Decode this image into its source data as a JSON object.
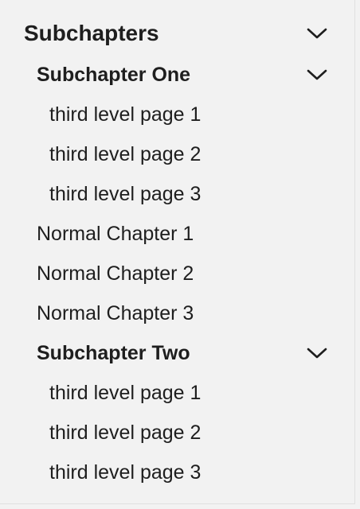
{
  "nav": {
    "section_title": "Subchapters",
    "sub_one": {
      "label": "Subchapter One",
      "pages": [
        "third level page 1",
        "third level page 2",
        "third level page 3"
      ]
    },
    "normal": [
      "Normal Chapter 1",
      "Normal Chapter 2",
      "Normal Chapter 3"
    ],
    "sub_two": {
      "label": "Subchapter Two",
      "pages": [
        "third level page 1",
        "third level page 2",
        "third level page 3"
      ]
    }
  },
  "icons": {
    "chevron": "chevron-down-icon"
  },
  "colors": {
    "background": "#f2f2f2",
    "text": "#1e1e1e"
  }
}
